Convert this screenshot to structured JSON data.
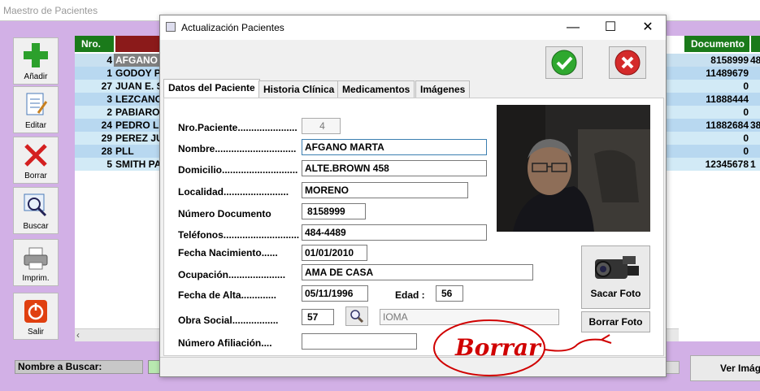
{
  "bg_window": {
    "title": "Maestro de Pacientes"
  },
  "sidebar": {
    "add": "Añadir",
    "edit": "Editar",
    "delete": "Borrar",
    "search": "Buscar",
    "print": "Imprim.",
    "exit": "Salir"
  },
  "grid": {
    "headers": {
      "nro": "Nro.",
      "documento": "Documento"
    },
    "rows": [
      {
        "nro": "4",
        "name": "AFGANO M",
        "doc": "8158999",
        "ex": "48"
      },
      {
        "nro": "1",
        "name": "GODOY PE",
        "doc": "11489679",
        "ex": ""
      },
      {
        "nro": "27",
        "name": "JUAN E. S",
        "doc": "0",
        "ex": ""
      },
      {
        "nro": "3",
        "name": "LEZCANO",
        "doc": "11888444",
        "ex": ""
      },
      {
        "nro": "2",
        "name": "PABIARO",
        "doc": "0",
        "ex": ""
      },
      {
        "nro": "24",
        "name": "PEDRO LA",
        "doc": "11882684",
        "ex": "38"
      },
      {
        "nro": "29",
        "name": "PEREZ JU",
        "doc": "0",
        "ex": ""
      },
      {
        "nro": "28",
        "name": "PLL",
        "doc": "0",
        "ex": ""
      },
      {
        "nro": "5",
        "name": "SMITH PA",
        "doc": "12345678",
        "ex": "1"
      }
    ]
  },
  "bottom": {
    "search_label": "Nombre a Buscar:",
    "ver_button": "Ver Imág"
  },
  "dialog": {
    "title": "Actualización Pacientes",
    "tabs": [
      "Datos del Paciente",
      "Historia Clínica",
      "Medicamentos",
      "Imágenes"
    ],
    "labels": {
      "nro": "Nro.Paciente......................",
      "nombre": "Nombre..............................",
      "domicilio": "Domicilio............................",
      "localidad": "Localidad........................",
      "documento": "Número Documento",
      "telefonos": "Teléfonos............................",
      "nacimiento": "Fecha Nacimiento......",
      "ocupacion": "Ocupación.....................",
      "alta": "Fecha de Alta.............",
      "edad": "Edad :",
      "obra": "Obra Social.................",
      "afiliacion": "Número Afiliación...."
    },
    "values": {
      "nro": "4",
      "nombre": "AFGANO MARTA",
      "domicilio": "ALTE.BROWN 458",
      "localidad": "MORENO",
      "documento": "8158999",
      "telefonos": "484-4489",
      "nacimiento": "01/01/2010",
      "ocupacion": "AMA DE CASA",
      "alta": "05/11/1996",
      "edad": "56",
      "obra_code": "57",
      "obra_name": "IOMA",
      "afiliacion": ""
    },
    "buttons": {
      "sacar_foto": "Sacar Foto",
      "borrar_foto": "Borrar Foto"
    },
    "annotation": "Borrar"
  },
  "colors": {
    "grid_header": "#1a7a1a",
    "annotation": "#d00000"
  }
}
